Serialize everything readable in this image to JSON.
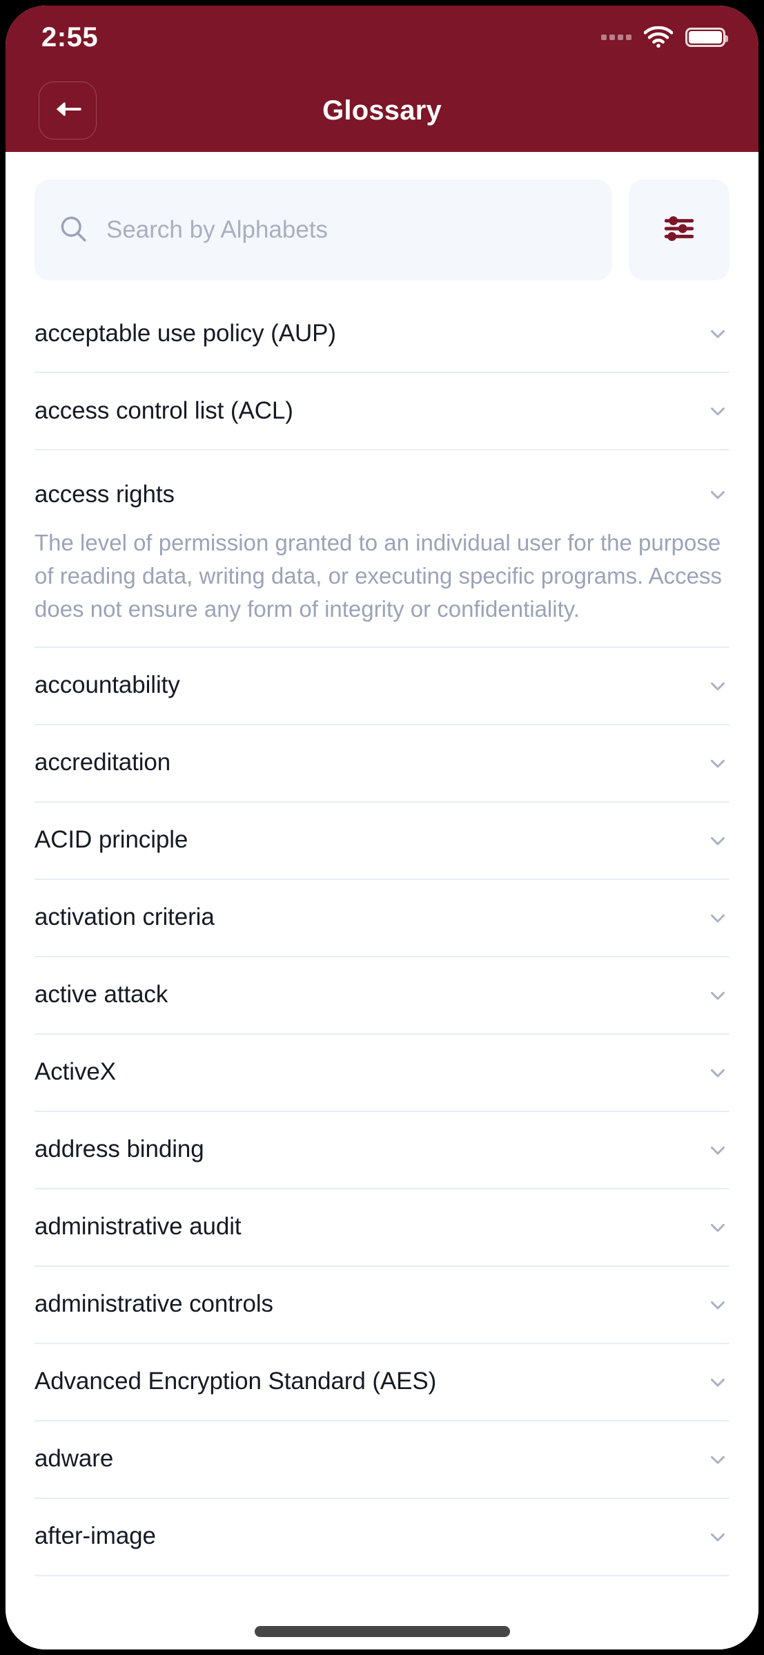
{
  "theme": {
    "header_bg": "#7D1628",
    "accent": "#7D1628",
    "field_bg": "#F4F7FC",
    "divider": "#E7ECF5",
    "term_color": "#151A24",
    "definition_color": "#9BA3B7",
    "placeholder_color": "#A9AFBE"
  },
  "status_bar": {
    "time": "2:55",
    "signal_icon": "signal-dots-icon",
    "wifi_icon": "wifi-icon",
    "battery_icon": "battery-full-icon"
  },
  "header": {
    "title": "Glossary",
    "back_icon": "arrow-left-icon"
  },
  "search": {
    "placeholder": "Search by Alphabets",
    "value": "",
    "search_icon": "search-icon",
    "filter_icon": "filter-sliders-icon"
  },
  "glossary": {
    "items": [
      {
        "term": "acceptable use policy (AUP)",
        "expanded": false,
        "definition": ""
      },
      {
        "term": "access control list (ACL)",
        "expanded": false,
        "definition": ""
      },
      {
        "term": "access rights",
        "expanded": true,
        "definition": "The level of permission granted to an individual user for the purpose of reading data, writing data, or executing specific programs. Access does not ensure any form of integrity or confidentiality."
      },
      {
        "term": "accountability",
        "expanded": false,
        "definition": ""
      },
      {
        "term": "accreditation",
        "expanded": false,
        "definition": ""
      },
      {
        "term": "ACID principle",
        "expanded": false,
        "definition": ""
      },
      {
        "term": "activation criteria",
        "expanded": false,
        "definition": ""
      },
      {
        "term": "active attack",
        "expanded": false,
        "definition": ""
      },
      {
        "term": "ActiveX",
        "expanded": false,
        "definition": ""
      },
      {
        "term": "address binding",
        "expanded": false,
        "definition": ""
      },
      {
        "term": "administrative audit",
        "expanded": false,
        "definition": ""
      },
      {
        "term": "administrative controls",
        "expanded": false,
        "definition": ""
      },
      {
        "term": "Advanced Encryption Standard (AES)",
        "expanded": false,
        "definition": ""
      },
      {
        "term": "adware",
        "expanded": false,
        "definition": ""
      },
      {
        "term": "after-image",
        "expanded": false,
        "definition": ""
      }
    ]
  }
}
